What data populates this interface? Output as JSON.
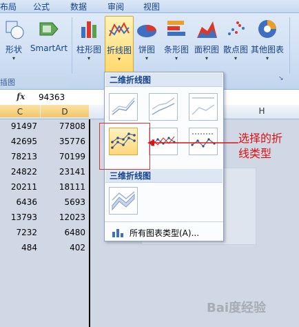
{
  "tabs": [
    "布局",
    "公式",
    "数据",
    "审阅",
    "视图"
  ],
  "ribbon": {
    "buttons": [
      {
        "label": "形状"
      },
      {
        "label": "SmartArt"
      },
      {
        "label": "柱形图"
      },
      {
        "label": "折线图"
      },
      {
        "label": "饼图"
      },
      {
        "label": "条形图"
      },
      {
        "label": "面积图"
      },
      {
        "label": "散点图"
      },
      {
        "label": "其他图表"
      }
    ],
    "group_label": "插图"
  },
  "formula_bar": {
    "fx": "fx",
    "value": "94363"
  },
  "sheet": {
    "columns": [
      "C",
      "D",
      "H"
    ],
    "rows": [
      {
        "c": "91497",
        "d": "77808"
      },
      {
        "c": "42695",
        "d": "35776"
      },
      {
        "c": "78213",
        "d": "70199"
      },
      {
        "c": "24822",
        "d": "23141"
      },
      {
        "c": "20211",
        "d": "18111"
      },
      {
        "c": "6436",
        "d": "5693"
      },
      {
        "c": "13793",
        "d": "12023"
      },
      {
        "c": "7232",
        "d": "6480"
      },
      {
        "c": "484",
        "d": "402"
      }
    ]
  },
  "dropdown": {
    "section_2d": "二维折线图",
    "section_3d": "三维折线图",
    "all_types": "所有图表类型(A)..."
  },
  "annotation": {
    "line1": "选择的折",
    "line2": "线类型"
  },
  "colors": {
    "accent": "#15428b",
    "annotation": "#e01010",
    "selected": "#ffd77a"
  }
}
